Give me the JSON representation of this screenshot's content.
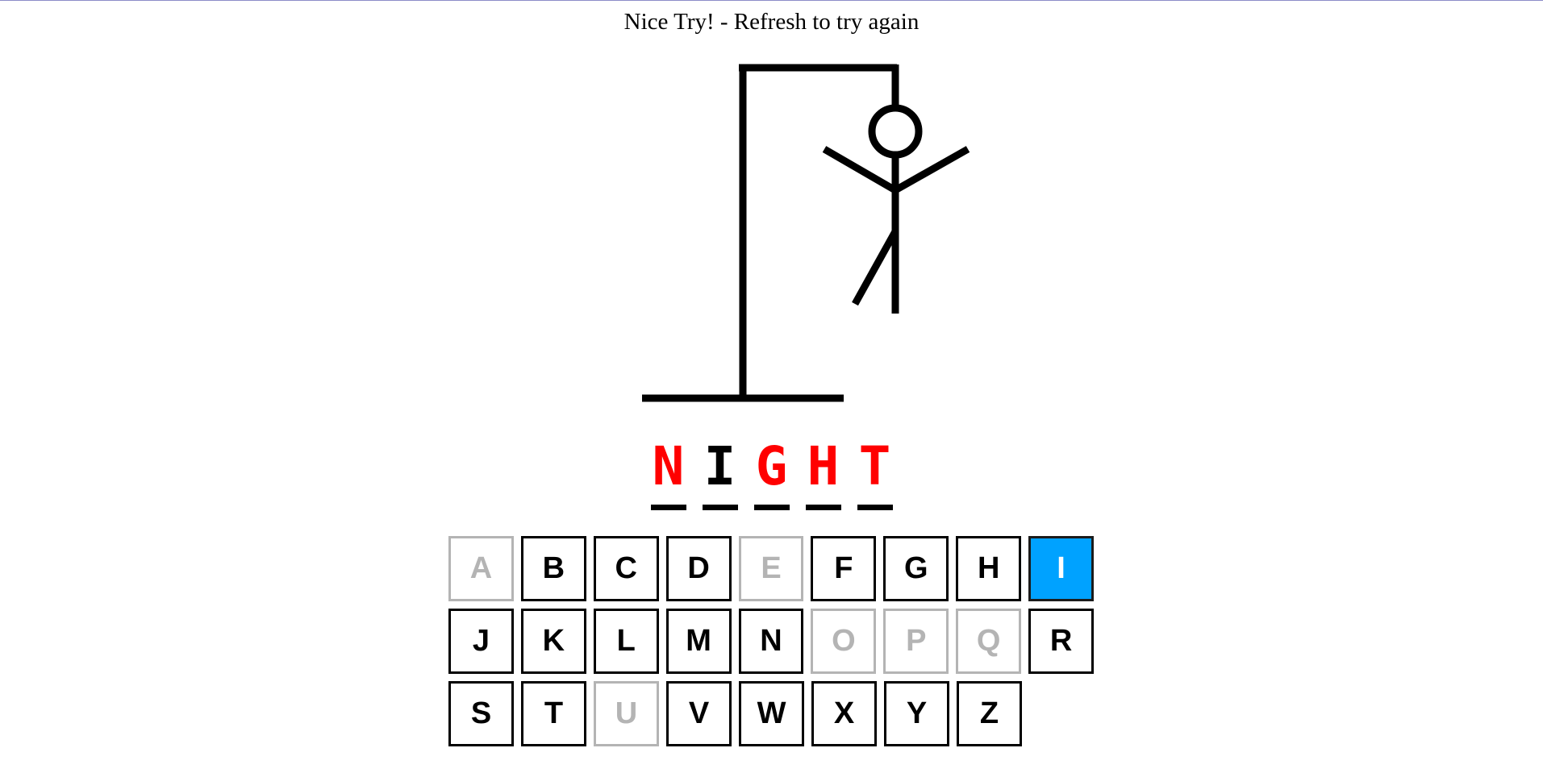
{
  "status_message": "Nice Try! - Refresh to try again",
  "word": [
    {
      "letter": "N",
      "state": "missed"
    },
    {
      "letter": "I",
      "state": "guessed"
    },
    {
      "letter": "G",
      "state": "missed"
    },
    {
      "letter": "H",
      "state": "missed"
    },
    {
      "letter": "T",
      "state": "missed"
    }
  ],
  "keyboard": {
    "rows": [
      [
        {
          "letter": "A",
          "state": "used"
        },
        {
          "letter": "B",
          "state": "available"
        },
        {
          "letter": "C",
          "state": "available"
        },
        {
          "letter": "D",
          "state": "available"
        },
        {
          "letter": "E",
          "state": "used"
        },
        {
          "letter": "F",
          "state": "available"
        },
        {
          "letter": "G",
          "state": "available"
        },
        {
          "letter": "H",
          "state": "available"
        },
        {
          "letter": "I",
          "state": "selected"
        }
      ],
      [
        {
          "letter": "J",
          "state": "available"
        },
        {
          "letter": "K",
          "state": "available"
        },
        {
          "letter": "L",
          "state": "available"
        },
        {
          "letter": "M",
          "state": "available"
        },
        {
          "letter": "N",
          "state": "available"
        },
        {
          "letter": "O",
          "state": "used"
        },
        {
          "letter": "P",
          "state": "used"
        },
        {
          "letter": "Q",
          "state": "used"
        },
        {
          "letter": "R",
          "state": "available"
        }
      ],
      [
        {
          "letter": "S",
          "state": "available"
        },
        {
          "letter": "T",
          "state": "available"
        },
        {
          "letter": "U",
          "state": "used"
        },
        {
          "letter": "V",
          "state": "available"
        },
        {
          "letter": "W",
          "state": "available"
        },
        {
          "letter": "X",
          "state": "available"
        },
        {
          "letter": "Y",
          "state": "available"
        },
        {
          "letter": "Z",
          "state": "available"
        }
      ]
    ]
  },
  "hangman": {
    "parts_drawn": [
      "base",
      "pole",
      "beam",
      "rope",
      "head",
      "body",
      "left-arm",
      "right-arm",
      "left-leg",
      "right-leg"
    ]
  },
  "colors": {
    "missed_letter": "#ff0000",
    "selected_key": "#00a2ff",
    "used_key": "#b4b4b4"
  }
}
